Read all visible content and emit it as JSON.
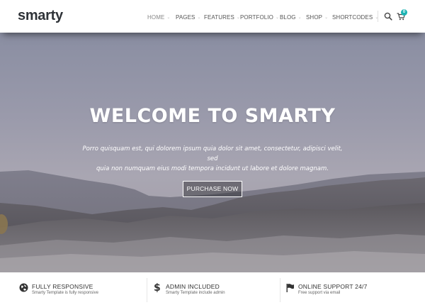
{
  "brand": {
    "logo": "smarty"
  },
  "nav": {
    "items": [
      {
        "label": "HOME",
        "active": true
      },
      {
        "label": "PAGES",
        "active": false
      },
      {
        "label": "FEATURES",
        "active": false
      },
      {
        "label": "PORTFOLIO",
        "active": false
      },
      {
        "label": "BLOG",
        "active": false
      },
      {
        "label": "SHOP",
        "active": false
      },
      {
        "label": "SHORTCODES",
        "active": false
      }
    ],
    "search_icon": "search-icon",
    "cart_icon": "cart-icon",
    "cart_count": "0"
  },
  "hero": {
    "title": "WELCOME TO SMARTY",
    "text_line1": "Porro quisquam est, qui dolorem ipsum quia dolor sit amet, consectetur, adipisci velit, sed",
    "text_line2": "quia non numquam eius modi tempora incidunt ut labore et dolore magnam.",
    "button_label": "PURCHASE NOW"
  },
  "features": [
    {
      "icon": "globe-icon",
      "title": "FULLY RESPONSIVE",
      "subtitle": "Smarty Template is fully responsive"
    },
    {
      "icon": "dollar-icon",
      "title": "ADMIN INCLUDED",
      "subtitle": "Smarty Template include admin"
    },
    {
      "icon": "flag-icon",
      "title": "ONLINE SUPPORT 24/7",
      "subtitle": "Free support via email"
    }
  ],
  "colors": {
    "accent": "#1bb3b3",
    "text_dark": "#2f3338",
    "hero_sky": "#8a8ea2"
  }
}
